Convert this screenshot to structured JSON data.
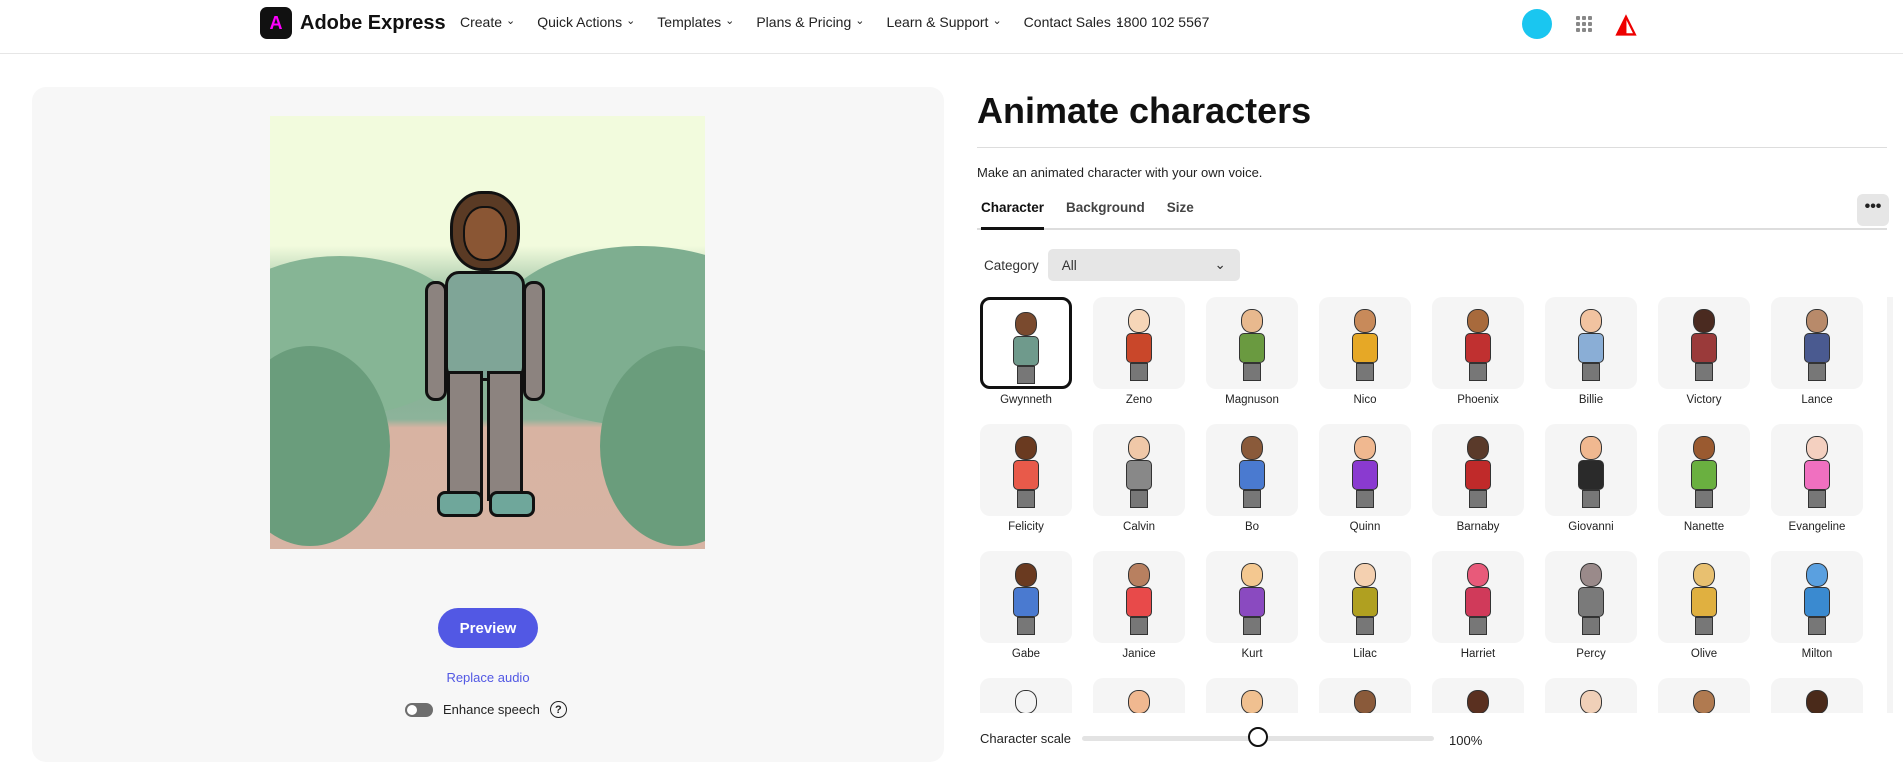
{
  "header": {
    "brand": "Adobe Express",
    "nav": [
      "Create",
      "Quick Actions",
      "Templates",
      "Plans & Pricing",
      "Learn & Support",
      "Contact Sales"
    ],
    "phone": "1800 102 5567",
    "adobe_logo": "A"
  },
  "preview_panel": {
    "preview_label": "Preview",
    "replace_audio": "Replace audio",
    "enhance_speech": "Enhance speech",
    "enhance_on": false,
    "help": "?"
  },
  "main": {
    "title": "Animate characters",
    "subtitle": "Make an animated character with your own voice.",
    "tabs": [
      "Character",
      "Background",
      "Size"
    ],
    "active_tab": "Character",
    "more": "•••",
    "category_label": "Category",
    "category_value": "All",
    "characters": [
      {
        "name": "Gwynneth",
        "color": "#6f9a8c",
        "skin": "#7a4a2e",
        "selected": true
      },
      {
        "name": "Zeno",
        "color": "#c9472a",
        "skin": "#f6d6b8"
      },
      {
        "name": "Magnuson",
        "color": "#6a9a40",
        "skin": "#e8b98e"
      },
      {
        "name": "Nico",
        "color": "#e6a826",
        "skin": "#c88a5a"
      },
      {
        "name": "Phoenix",
        "color": "#c03030",
        "skin": "#a86a3c"
      },
      {
        "name": "Billie",
        "color": "#8aaed6",
        "skin": "#f1c3a0"
      },
      {
        "name": "Victory",
        "color": "#9a3a3a",
        "skin": "#4a2a20"
      },
      {
        "name": "Lance",
        "color": "#4a5a90",
        "skin": "#b88a6a"
      },
      {
        "name": "Felicity",
        "color": "#e85a4a",
        "skin": "#6a3a20"
      },
      {
        "name": "Calvin",
        "color": "#888888",
        "skin": "#f0c8a8"
      },
      {
        "name": "Bo",
        "color": "#4a7ad0",
        "skin": "#8a5a3a"
      },
      {
        "name": "Quinn",
        "color": "#8a3ad0",
        "skin": "#f0b890"
      },
      {
        "name": "Barnaby",
        "color": "#c02a2a",
        "skin": "#5a3a2a"
      },
      {
        "name": "Giovanni",
        "color": "#2a2a2a",
        "skin": "#f0b890"
      },
      {
        "name": "Nanette",
        "color": "#6ab040",
        "skin": "#9a5a30"
      },
      {
        "name": "Evangeline",
        "color": "#f070c0",
        "skin": "#f4d0c0"
      },
      {
        "name": "Gabe",
        "color": "#4a7ad0",
        "skin": "#6a3a20"
      },
      {
        "name": "Janice",
        "color": "#e84a4a",
        "skin": "#b88060"
      },
      {
        "name": "Kurt",
        "color": "#8a4ac0",
        "skin": "#f4c890"
      },
      {
        "name": "Lilac",
        "color": "#b0a020",
        "skin": "#f4d0b0"
      },
      {
        "name": "Harriet",
        "color": "#d03a5a",
        "skin": "#e85a7a"
      },
      {
        "name": "Percy",
        "color": "#7a7a7a",
        "skin": "#9a8a8a"
      },
      {
        "name": "Olive",
        "color": "#e0b040",
        "skin": "#e8c070"
      },
      {
        "name": "Milton",
        "color": "#3a8ad0",
        "skin": "#5aa0e0"
      },
      {
        "name": "",
        "color": "#eee",
        "skin": "#f4f4f4"
      },
      {
        "name": "",
        "color": "#f04a4a",
        "skin": "#f0b890"
      },
      {
        "name": "",
        "color": "#5a3a2a",
        "skin": "#f0c090"
      },
      {
        "name": "",
        "color": "#2aa0d0",
        "skin": "#8a5a3a"
      },
      {
        "name": "",
        "color": "#6a3a20",
        "skin": "#5a3020"
      },
      {
        "name": "",
        "color": "#ddd",
        "skin": "#f0d0b8"
      },
      {
        "name": "",
        "color": "#8a5a30",
        "skin": "#b07a50"
      },
      {
        "name": "",
        "color": "#3a6ad0",
        "skin": "#4a2a1a"
      }
    ],
    "scale_label": "Character scale",
    "scale_value": "100%",
    "scale_fraction": 0.5
  }
}
